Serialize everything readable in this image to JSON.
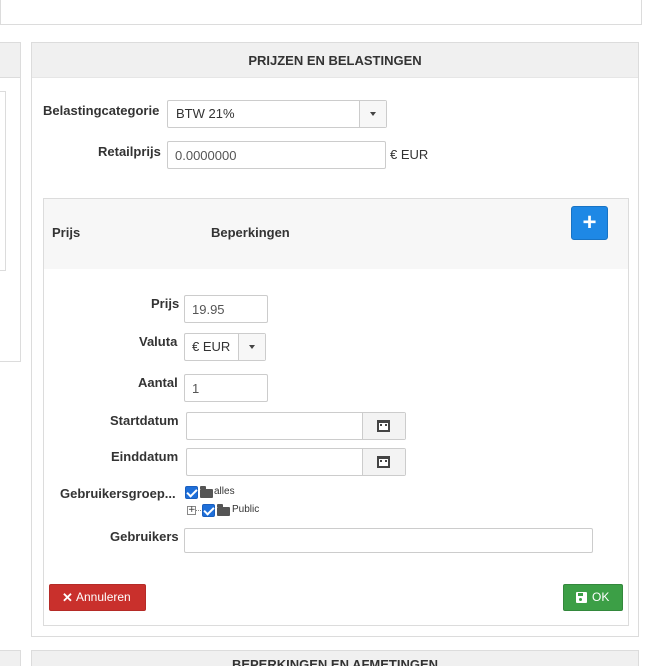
{
  "panel": {
    "title": "PRIJZEN EN BELASTINGEN",
    "tax_label": "Belastingcategorie",
    "tax_value": "BTW 21%",
    "retail_label": "Retailprijs",
    "retail_value": "0.0000000",
    "retail_currency": "€ EUR"
  },
  "price_table": {
    "col_price": "Prijs",
    "col_restrictions": "Beperkingen",
    "add_label": "+"
  },
  "form": {
    "price_label": "Prijs",
    "price_value": "19.95",
    "currency_label": "Valuta",
    "currency_value": "€ EUR",
    "quantity_label": "Aantal",
    "quantity_value": "1",
    "start_label": "Startdatum",
    "start_value": "",
    "end_label": "Einddatum",
    "end_value": "",
    "groups_label": "Gebruikersgroep...",
    "groups": [
      {
        "label": "alles",
        "checked": true
      },
      {
        "label": "Public",
        "checked": true
      }
    ],
    "users_label": "Gebruikers",
    "users_value": ""
  },
  "actions": {
    "cancel_label": "Annuleren",
    "ok_label": "OK"
  },
  "next_panel": {
    "title": "BEPERKINGEN EN AFMETINGEN"
  },
  "colors": {
    "primary": "#1e88e5",
    "danger": "#c9302c",
    "success": "#3c9f46"
  }
}
